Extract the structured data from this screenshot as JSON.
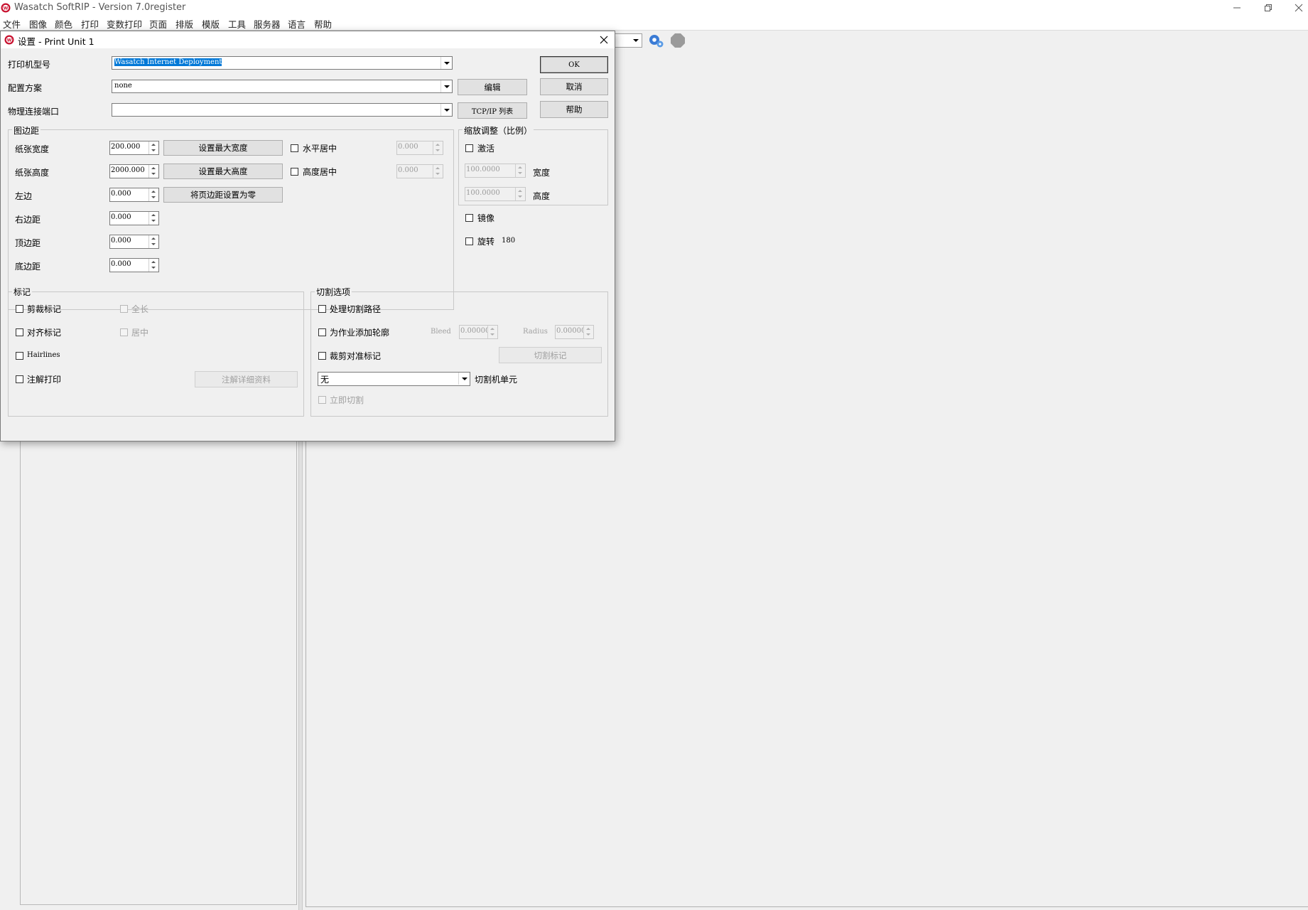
{
  "app": {
    "title": "Wasatch SoftRIP  - Version 7.0register",
    "menu": [
      "文件",
      "图像",
      "颜色",
      "打印",
      "变数打印",
      "页面",
      "排版",
      "模版",
      "工具",
      "服务器",
      "语言",
      "帮助"
    ]
  },
  "dialog": {
    "title": "设置 - Print Unit 1",
    "printer_model_label": "打印机型号",
    "printer_model_value": "Wasatch  Internet Deployment",
    "config_label": "配置方案",
    "config_value": "none",
    "port_label": "物理连接端口",
    "port_value": "",
    "buttons": {
      "ok": "OK",
      "cancel": "取消",
      "help": "帮助",
      "edit": "编辑",
      "tcpip": "TCP/IP 列表"
    },
    "margins": {
      "group_title": "图边距",
      "paper_width_label": "纸张宽度",
      "paper_width_value": "200.000",
      "paper_height_label": "纸张高度",
      "paper_height_value": "2000.000",
      "left_label": "左边",
      "left_value": "0.000",
      "right_label": "右边距",
      "right_value": "0.000",
      "top_label": "顶边距",
      "top_value": "0.000",
      "bottom_label": "底边距",
      "bottom_value": "0.000",
      "set_max_width": "设置最大宽度",
      "set_max_height": "设置最大高度",
      "zero_margins": "将页边距设置为零",
      "h_center_label": "水平居中",
      "h_center_value": "0.000",
      "v_center_label": "高度居中",
      "v_center_value": "0.000"
    },
    "scaling": {
      "group_title": "缩放调整（比例）",
      "activate_label": "激活",
      "width_value": "100.0000",
      "width_label": "宽度",
      "height_value": "100.0000",
      "height_label": "高度",
      "mirror_label": "镜像",
      "rotate_label": "旋转",
      "rotate_value": "180"
    },
    "marks": {
      "group_title": "标记",
      "crop_marks": "剪裁标记",
      "full_length": "全长",
      "align_marks": "对齐标记",
      "center": "居中",
      "hairlines": "Hairlines",
      "annotate": "注解打印",
      "annotate_details": "注解详细资料"
    },
    "cut": {
      "group_title": "切割选项",
      "process_cut_path": "处理切割路径",
      "add_contour": "为作业添加轮廓",
      "bleed_label": "Bleed",
      "bleed_value": "0.00000",
      "radius_label": "Radius",
      "radius_value": "0.00000",
      "crop_register_marks": "裁剪对准标记",
      "cut_marks_button": "切割标记",
      "cutter_value": "无",
      "cutter_label": "切割机单元",
      "cut_immediately": "立即切割"
    }
  },
  "colors": {
    "selection": "#0078d7",
    "dialog_bg": "#f0f0f0",
    "disabled_text": "#a0a0a0"
  }
}
